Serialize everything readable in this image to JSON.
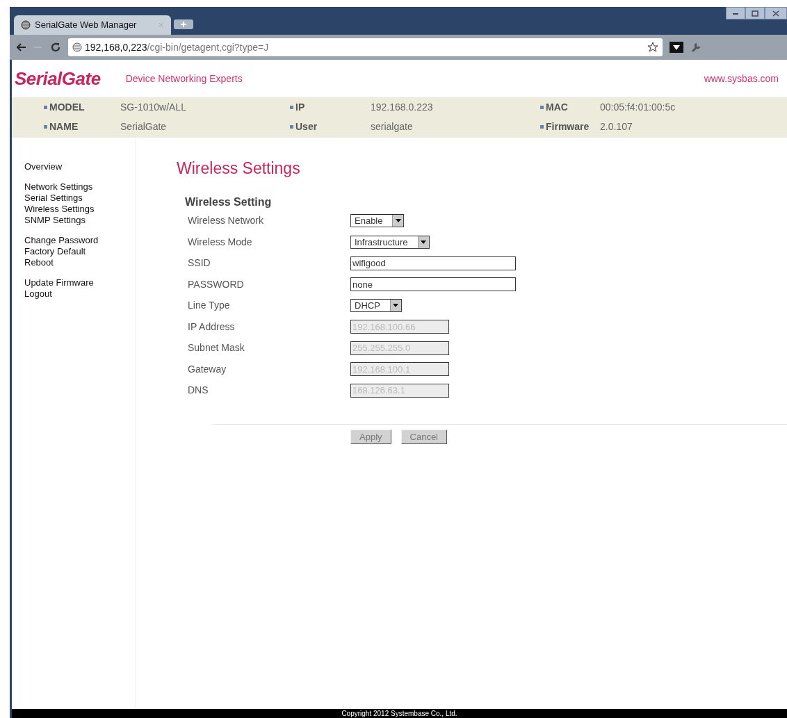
{
  "browser": {
    "tab": {
      "title": "SerialGate Web Manager",
      "selected": true
    },
    "url_host": "192,168,0,223",
    "url_path": "/cgi-bin/getagent,cgi?type=J"
  },
  "header": {
    "logo": "SerialGate",
    "tagline": "Device Networking Experts",
    "site": "www.sysbas.com"
  },
  "info": [
    {
      "label": "MODEL",
      "value": "SG-1010w/ALL"
    },
    {
      "label": "IP",
      "value": "192.168.0.223"
    },
    {
      "label": "MAC",
      "value": "00:05:f4:01:00:5c"
    },
    {
      "label": "NAME",
      "value": "SerialGate"
    },
    {
      "label": "User",
      "value": "serialgate"
    },
    {
      "label": "Firmware",
      "value": "2.0.107"
    }
  ],
  "sidebar": {
    "groups": [
      [
        "Overview"
      ],
      [
        "Network Settings",
        "Serial Settings",
        "Wireless Settings",
        "SNMP Settings"
      ],
      [
        "Change Password",
        "Factory Default",
        "Reboot"
      ],
      [
        "Update Firmware",
        "Logout"
      ]
    ]
  },
  "page_title": "Wireless Settings",
  "section_title": "Wireless Setting",
  "fields": [
    {
      "label": "Wireless Network",
      "kind": "select",
      "value": "Enable",
      "disabled": false
    },
    {
      "label": "Wireless Mode",
      "kind": "select",
      "value": "Infrastructure",
      "disabled": false
    },
    {
      "label": "SSID",
      "kind": "text",
      "value": "wifigood",
      "disabled": false
    },
    {
      "label": "PASSWORD",
      "kind": "text",
      "value": "none",
      "disabled": false
    },
    {
      "label": "Line Type",
      "kind": "select",
      "value": "DHCP",
      "disabled": false
    },
    {
      "label": "IP Address",
      "kind": "text",
      "value": "192.168.100.66",
      "disabled": true
    },
    {
      "label": "Subnet Mask",
      "kind": "text",
      "value": "255.255.255.0",
      "disabled": true
    },
    {
      "label": "Gateway",
      "kind": "text",
      "value": "192.168.100.1",
      "disabled": true
    },
    {
      "label": "DNS",
      "kind": "text",
      "value": "168.126.63.1",
      "disabled": true
    }
  ],
  "buttons": [
    "Apply",
    "Cancel"
  ],
  "footer": "Copyright 2012 Systembase Co., Ltd."
}
